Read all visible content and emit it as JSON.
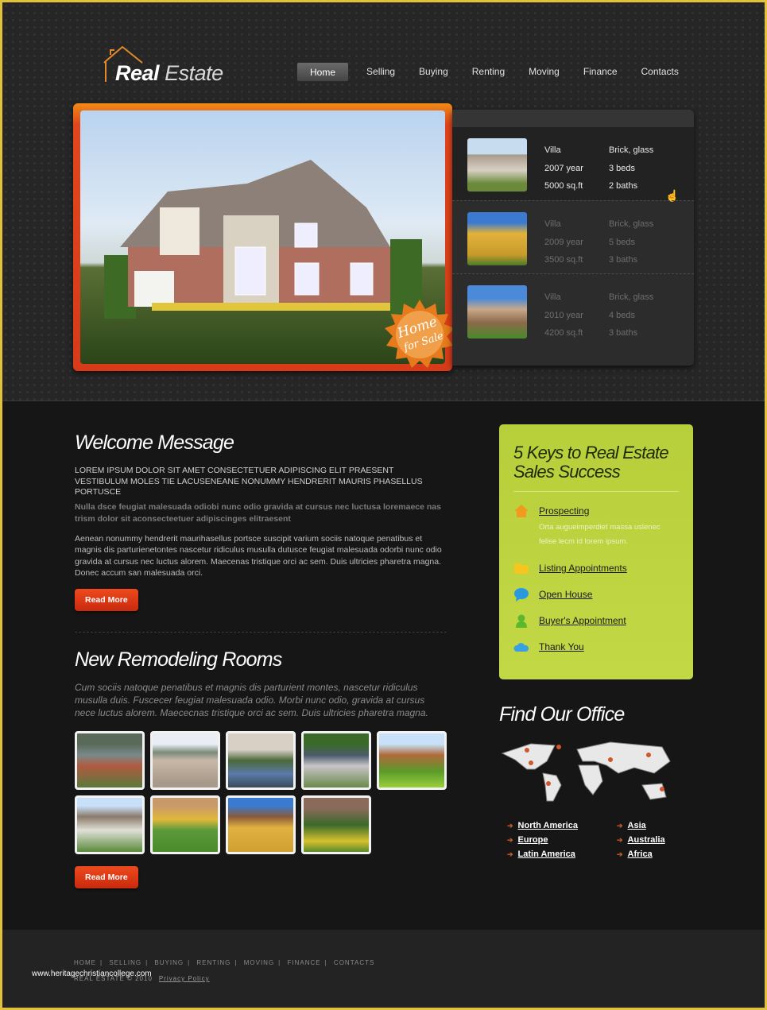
{
  "header": {
    "logo_bold": "Real",
    "logo_light": "Estate",
    "nav": [
      {
        "label": "Home",
        "active": true
      },
      {
        "label": "Selling"
      },
      {
        "label": "Buying"
      },
      {
        "label": "Renting"
      },
      {
        "label": "Moving"
      },
      {
        "label": "Finance"
      },
      {
        "label": "Contacts"
      }
    ]
  },
  "hero": {
    "badge_line1": "Home",
    "badge_line2": "for Sale",
    "accent": "#e3451c"
  },
  "listings": [
    {
      "type": "Villa",
      "year": "2007 year",
      "area": "5000 sq.ft",
      "material": "Brick, glass",
      "beds": "3 beds",
      "baths": "2 baths",
      "active": true
    },
    {
      "type": "Villa",
      "year": "2009 year",
      "area": "3500 sq.ft",
      "material": "Brick, glass",
      "beds": "5 beds",
      "baths": "3 baths"
    },
    {
      "type": "Villa",
      "year": "2010 year",
      "area": "4200 sq.ft",
      "material": "Brick, glass",
      "beds": "4 beds",
      "baths": "3 baths"
    }
  ],
  "welcome": {
    "title": "Welcome Message",
    "upper": "LOREM IPSUM DOLOR SIT AMET CONSECTETUER ADIPISCING ELIT PRAESENT VESTIBULUM MOLES TIE LACUSENEANE NONUMMY HENDRERIT MAURIS PHASELLUS PORTUSCE",
    "grey": "Nulla dsce feugiat malesuada odiobi nunc odio gravida at cursus nec luctusa loremaece nas trism dolor sit aconsecteetuer adipiscinges elitraesent",
    "body": "Aenean nonummy hendrerit maurihasellus portsce suscipit varium sociis natoque penatibus et magnis dis parturienetontes nascetur ridiculus musulla dutusce feugiat malesuada odorbi nunc odio gravida at cursus nec luctus alorem. Maecenas tristique orci ac sem. Duis ultricies pharetra magna. Donec accum san malesuada orci.",
    "button": "Read More"
  },
  "remodeling": {
    "title": "New Remodeling Rooms",
    "text": "Cum sociis natoque penatibus et magnis dis parturient montes, nascetur ridiculus musulla duis. Fuscecer feugiat malesuada odio. Morbi nunc odio, gravida at cursus nece luctus alorem. Maececnas tristique orci ac sem. Duis ultricies pharetra magna.",
    "button": "Read More",
    "photo_count": 9
  },
  "keys": {
    "title_line1": "5 Keys to Real Estate",
    "title_line2": "Sales Success",
    "items": [
      {
        "icon": "house-icon",
        "label": "Prospecting",
        "desc": "Orta augueimperdiet massa uslenec felise lecm id lorem ipsum."
      },
      {
        "icon": "folder-icon",
        "label": "Listing Appointments"
      },
      {
        "icon": "speech-bubble-icon",
        "label": "Open House"
      },
      {
        "icon": "user-icon",
        "label": "Buyer's Appointment"
      },
      {
        "icon": "cloud-icon",
        "label": "Thank You"
      }
    ]
  },
  "office": {
    "title": "Find Our Office",
    "regions": [
      "North America",
      "Asia",
      "Europe",
      "Australia",
      "Latin America",
      "Africa"
    ]
  },
  "footer": {
    "nav": [
      "HOME",
      "SELLING",
      "BUYING",
      "RENTING",
      "MOVING",
      "FINANCE",
      "CONTACTS"
    ],
    "copyright": "REAL ESTATE © 2010",
    "privacy": "Privacy Policy",
    "watermark": "www.heritagechristiancollege.com"
  }
}
